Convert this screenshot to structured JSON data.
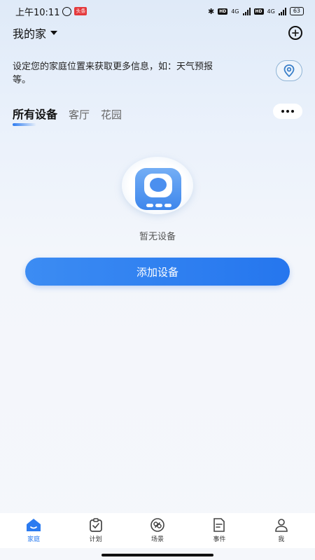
{
  "status_bar": {
    "time": "上午10:11",
    "notification": "头条",
    "network_1": "4G",
    "network_2": "4G",
    "hd_1": "HD",
    "hd_2": "HD",
    "battery": "63"
  },
  "header": {
    "home_name": "我的家"
  },
  "location_hint": {
    "text": "设定您的家庭位置来获取更多信息，如：天气预报等。"
  },
  "tabs": [
    {
      "label": "所有设备",
      "active": true
    },
    {
      "label": "客厅",
      "active": false
    },
    {
      "label": "花园",
      "active": false
    }
  ],
  "empty_state": {
    "text": "暂无设备",
    "button_label": "添加设备"
  },
  "bottom_nav": [
    {
      "label": "家庭",
      "icon": "home-icon",
      "active": true
    },
    {
      "label": "计划",
      "icon": "clipboard-check-icon",
      "active": false
    },
    {
      "label": "场景",
      "icon": "link-icon",
      "active": false
    },
    {
      "label": "事件",
      "icon": "document-icon",
      "active": false
    },
    {
      "label": "我",
      "icon": "user-icon",
      "active": false
    }
  ],
  "colors": {
    "accent": "#2b7bf0",
    "background_top": "#dfeaf8",
    "background_bottom": "#f5f7fb"
  }
}
